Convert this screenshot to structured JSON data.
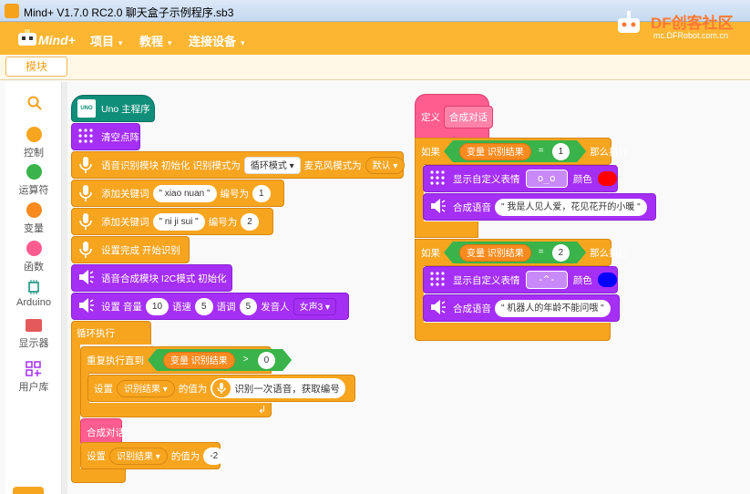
{
  "window": {
    "title": "Mind+ V1.7.0 RC2.0    聊天盒子示例程序.sb3"
  },
  "menu": {
    "logo": "Mind+",
    "items": [
      {
        "label": "项目"
      },
      {
        "label": "教程"
      },
      {
        "label": "连接设备"
      }
    ],
    "dropdown_glyph": "▾"
  },
  "brand": {
    "name": "DF创客社区",
    "url": "mc.DFRobot.com.cn"
  },
  "tabs": {
    "blocks": "模块"
  },
  "sidebar": {
    "search_icon": "search-icon",
    "categories": [
      {
        "label": "控制",
        "color": "#f7a51f"
      },
      {
        "label": "运算符",
        "color": "#39b34a"
      },
      {
        "label": "变量",
        "color": "#f78b1f"
      },
      {
        "label": "函数",
        "color": "#ff5c8f"
      },
      {
        "label": "Arduino",
        "color": "#0f8e7a"
      },
      {
        "label": "显示器",
        "color": "#e45a5a"
      },
      {
        "label": "用户库",
        "color": "#a52ff5"
      }
    ]
  },
  "script_main": {
    "hat": "Uno 主程序",
    "hat_icon_text": "UNO",
    "clear": "清空点阵",
    "asr_init": {
      "text": "语音识别模块 初始化 识别模式为",
      "mode": "循环模式",
      "mic_label": "麦克风模式为",
      "mic": "默认"
    },
    "kw1": {
      "text": "添加关键词",
      "word": "\" xiao nuan \"",
      "num_label": "编号为",
      "num": "1"
    },
    "kw2": {
      "text": "添加关键词",
      "word": "\" ni ji sui \"",
      "num_label": "编号为",
      "num": "2"
    },
    "finish": "设置完成 开始识别",
    "tts_init": "语音合成模块 I2C模式 初始化",
    "tts_set": {
      "text": "设置 音量",
      "vol": "10",
      "speed_label": "语速",
      "speed": "5",
      "tone_label": "语调",
      "tone": "5",
      "voice_label": "发音人",
      "voice": "女声3"
    },
    "loop": "循环执行",
    "repeat_until": "重复执行直到",
    "cond_var": "变量 识别结果",
    "cond_op": ">",
    "cond_val": "0",
    "set1": {
      "label": "设置",
      "var": "识别结果",
      "to": "的值为",
      "reporter": "识别一次语音，获取编号"
    },
    "call": "合成对话",
    "set2": {
      "label": "设置",
      "var": "识别结果",
      "to": "的值为",
      "val": "-2"
    }
  },
  "script_func": {
    "define": "定义",
    "name": "合成对话",
    "if1": {
      "if": "如果",
      "var": "变量 识别结果",
      "op": "=",
      "val": "1",
      "then": "那么执行"
    },
    "show1": {
      "text": "显示自定义表情",
      "face": "o_o",
      "color_label": "颜色",
      "color": "#ff0000"
    },
    "say1": {
      "text": "合成语音",
      "content": "\" 我是人见人爱，花见花开的小暖 \""
    },
    "if2": {
      "if": "如果",
      "var": "变量 识别结果",
      "op": "=",
      "val": "2",
      "then": "那么执行"
    },
    "show2": {
      "text": "显示自定义表情",
      "face": "-^-",
      "color_label": "颜色",
      "color": "#0000ff"
    },
    "say2": {
      "text": "合成语音",
      "content": "\" 机器人的年龄不能问哦 \""
    }
  }
}
